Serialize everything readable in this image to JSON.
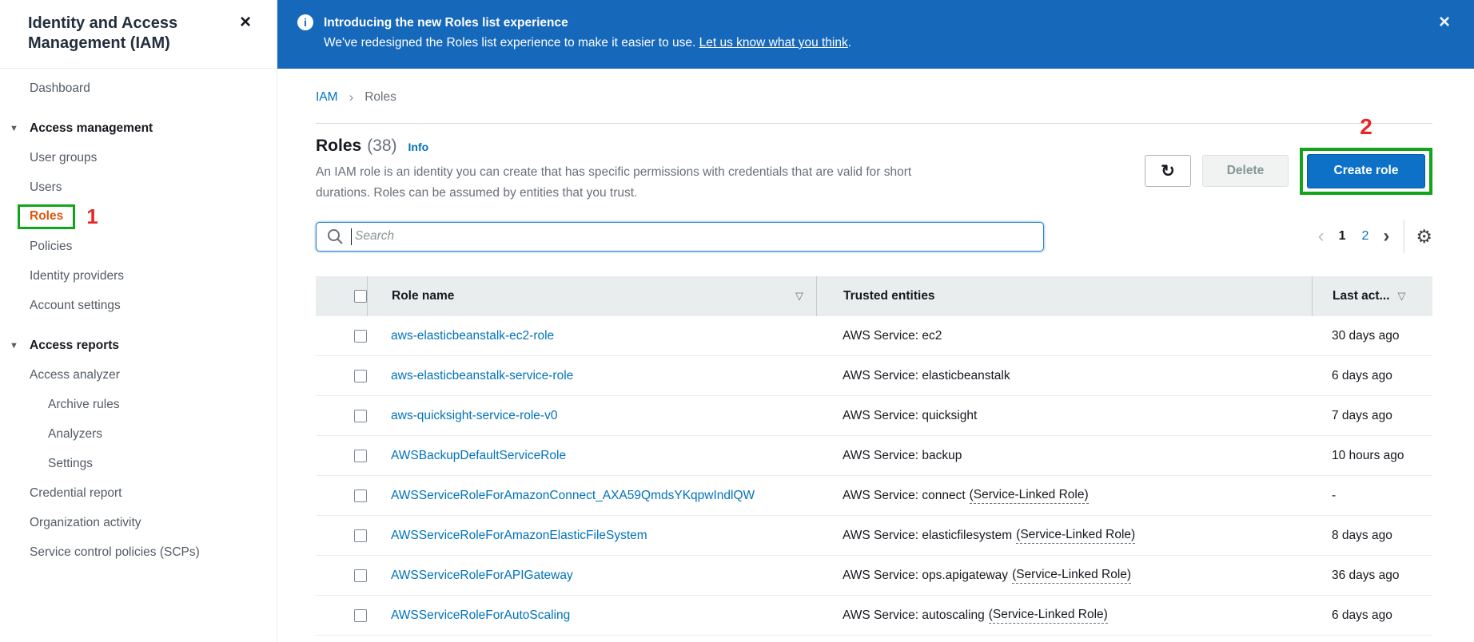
{
  "colors": {
    "banner_blue": "#1668bb",
    "link_blue": "#0073bb",
    "primary_button_blue": "#0d72c7",
    "active_nav_orange": "#dd570e",
    "annotation_green": "#12a41a",
    "annotation_red": "#e92528",
    "table_header_gray": "#eaeded"
  },
  "sidebar": {
    "title": "Identity and Access Management (IAM)",
    "close_icon": "×",
    "dashboard": "Dashboard",
    "sections": [
      {
        "header": "Access management",
        "items": [
          {
            "label": "User groups"
          },
          {
            "label": "Users"
          },
          {
            "label": "Roles",
            "active": true
          },
          {
            "label": "Policies"
          },
          {
            "label": "Identity providers"
          },
          {
            "label": "Account settings"
          }
        ]
      },
      {
        "header": "Access reports",
        "items": [
          {
            "label": "Access analyzer"
          },
          {
            "label": "Archive rules",
            "sub": true
          },
          {
            "label": "Analyzers",
            "sub": true
          },
          {
            "label": "Settings",
            "sub": true
          },
          {
            "label": "Credential report"
          },
          {
            "label": "Organization activity"
          },
          {
            "label": "Service control policies (SCPs)"
          }
        ]
      }
    ]
  },
  "banner": {
    "info_icon": "i",
    "title": "Introducing the new Roles list experience",
    "message": "We've redesigned the Roles list experience to make it easier to use. ",
    "link_text": "Let us know what you think",
    "message_suffix": ".",
    "close_icon": "×"
  },
  "breadcrumb": {
    "root": "IAM",
    "current": "Roles"
  },
  "page_header": {
    "title": "Roles",
    "count": "(38)",
    "info_label": "Info",
    "description_line1": "An IAM role is an identity you can create that has specific permissions with credentials that are valid for short",
    "description_line2": "durations. Roles can be assumed by entities that you trust."
  },
  "toolbar": {
    "refresh_icon": "↻",
    "delete_label": "Delete",
    "create_label": "Create role"
  },
  "annotations": {
    "step1": "1",
    "step2": "2"
  },
  "search": {
    "placeholder": "Search"
  },
  "pagination": {
    "prev": "‹",
    "page1": "1",
    "page2": "2",
    "next": "›",
    "gear_icon": "⚙",
    "current_page": "1"
  },
  "table": {
    "columns": {
      "role_name": "Role name",
      "trusted_entities": "Trusted entities",
      "last_activity": "Last act...",
      "sort_icon": "▽"
    },
    "rows": [
      {
        "role_name": "aws-elasticbeanstalk-ec2-role",
        "trusted": "AWS Service: ec2",
        "trusted_linked": "",
        "last_activity": "30 days ago"
      },
      {
        "role_name": "aws-elasticbeanstalk-service-role",
        "trusted": "AWS Service: elasticbeanstalk",
        "trusted_linked": "",
        "last_activity": "6 days ago"
      },
      {
        "role_name": "aws-quicksight-service-role-v0",
        "trusted": "AWS Service: quicksight",
        "trusted_linked": "",
        "last_activity": "7 days ago"
      },
      {
        "role_name": "AWSBackupDefaultServiceRole",
        "trusted": "AWS Service: backup",
        "trusted_linked": "",
        "last_activity": "10 hours ago"
      },
      {
        "role_name": "AWSServiceRoleForAmazonConnect_AXA59QmdsYKqpwIndlQW",
        "trusted": "AWS Service: connect",
        "trusted_linked": "(Service-Linked Role)",
        "last_activity": "-"
      },
      {
        "role_name": "AWSServiceRoleForAmazonElasticFileSystem",
        "trusted": "AWS Service: elasticfilesystem",
        "trusted_linked": "(Service-Linked Role)",
        "last_activity": "8 days ago"
      },
      {
        "role_name": "AWSServiceRoleForAPIGateway",
        "trusted": "AWS Service: ops.apigateway",
        "trusted_linked": "(Service-Linked Role)",
        "last_activity": "36 days ago"
      },
      {
        "role_name": "AWSServiceRoleForAutoScaling",
        "trusted": "AWS Service: autoscaling",
        "trusted_linked": "(Service-Linked Role)",
        "last_activity": "6 days ago"
      }
    ]
  }
}
